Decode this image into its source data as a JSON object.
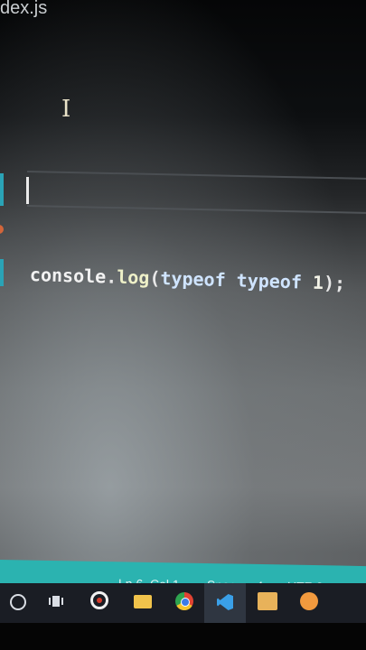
{
  "editor": {
    "tab_title": "dex.js",
    "code": {
      "object": "console",
      "dot": ".",
      "method": "log",
      "open_paren": "(",
      "kw1": "typeof",
      "kw2": "typeof",
      "number": "1",
      "close": ");"
    }
  },
  "status_bar": {
    "position": "Ln 6, Col 1",
    "spaces": "Spaces: 4",
    "encoding": "UTF-8",
    "eol": "CR",
    "color": "#2bb3b0"
  },
  "taskbar": {
    "icons": [
      "start-icon",
      "task-view-icon",
      "media-player-icon",
      "file-explorer-icon",
      "chrome-icon",
      "vscode-icon",
      "sticky-notes-icon",
      "app-icon"
    ]
  }
}
